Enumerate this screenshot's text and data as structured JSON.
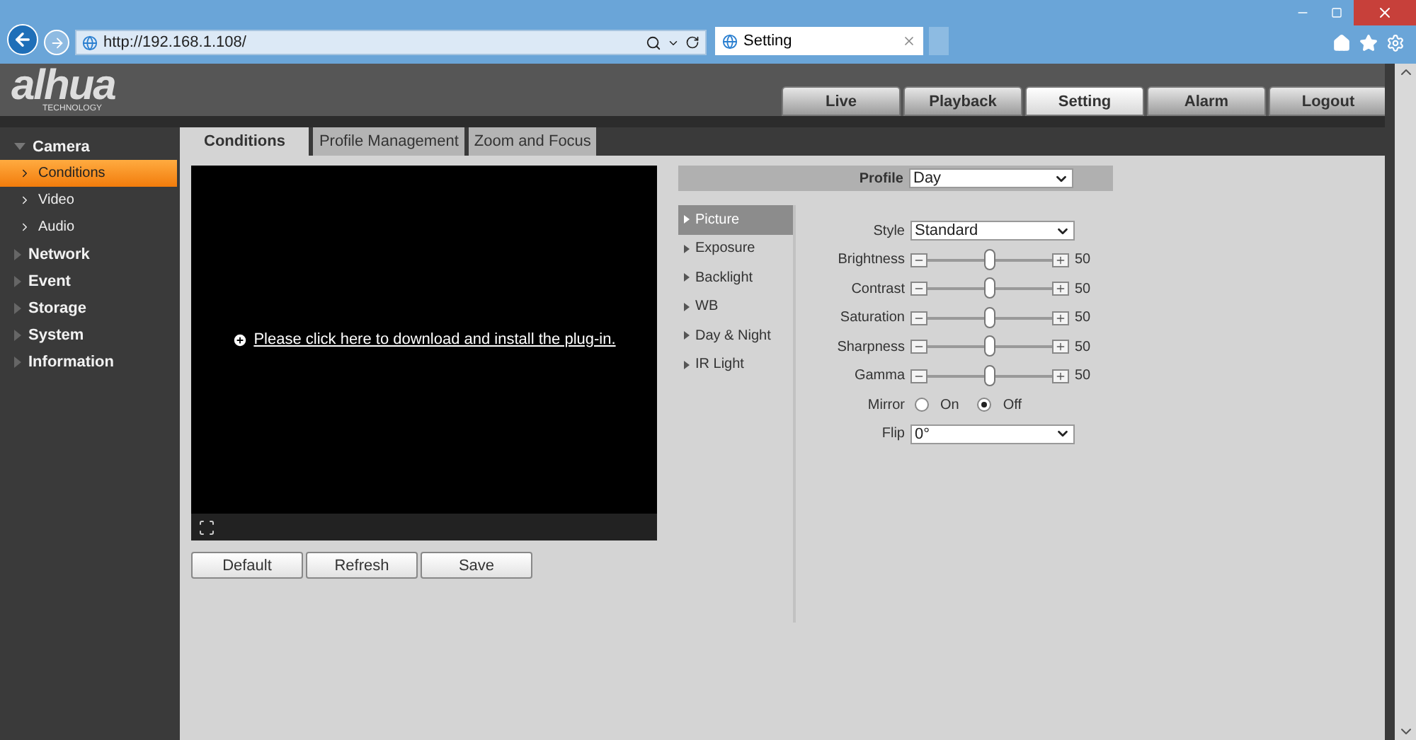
{
  "browser": {
    "url": "http://192.168.1.108/",
    "tab_title": "Setting"
  },
  "logo": {
    "text": "alhua",
    "subtitle": "TECHNOLOGY"
  },
  "nav": [
    {
      "label": "Live",
      "selected": false
    },
    {
      "label": "Playback",
      "selected": false
    },
    {
      "label": "Setting",
      "selected": true
    },
    {
      "label": "Alarm",
      "selected": false
    },
    {
      "label": "Logout",
      "selected": false
    }
  ],
  "sidebar": [
    {
      "label": "Camera",
      "expanded": true,
      "children": [
        {
          "label": "Conditions",
          "selected": true
        },
        {
          "label": "Video",
          "selected": false
        },
        {
          "label": "Audio",
          "selected": false
        }
      ]
    },
    {
      "label": "Network",
      "expanded": false
    },
    {
      "label": "Event",
      "expanded": false
    },
    {
      "label": "Storage",
      "expanded": false
    },
    {
      "label": "System",
      "expanded": false
    },
    {
      "label": "Information",
      "expanded": false
    }
  ],
  "tabs": [
    {
      "label": "Conditions",
      "selected": true
    },
    {
      "label": "Profile Management",
      "selected": false
    },
    {
      "label": "Zoom and Focus",
      "selected": false
    }
  ],
  "video": {
    "plugin_link": "Please click here to download and install the plug-in."
  },
  "buttons": [
    "Default",
    "Refresh",
    "Save"
  ],
  "profile": {
    "label": "Profile",
    "value": "Day"
  },
  "menu": [
    {
      "label": "Picture",
      "selected": true
    },
    {
      "label": "Exposure",
      "selected": false
    },
    {
      "label": "Backlight",
      "selected": false
    },
    {
      "label": "WB",
      "selected": false
    },
    {
      "label": "Day & Night",
      "selected": false
    },
    {
      "label": "IR Light",
      "selected": false
    }
  ],
  "settings": [
    {
      "kind": "select",
      "label": "Style",
      "value": "Standard"
    },
    {
      "kind": "slider",
      "label": "Brightness",
      "level": 0.5,
      "reading": "50"
    },
    {
      "kind": "slider",
      "label": "Contrast",
      "level": 0.5,
      "reading": "50"
    },
    {
      "kind": "slider",
      "label": "Saturation",
      "level": 0.5,
      "reading": "50"
    },
    {
      "kind": "slider",
      "label": "Sharpness",
      "level": 0.5,
      "reading": "50"
    },
    {
      "kind": "slider",
      "label": "Gamma",
      "level": 0.5,
      "reading": "50"
    },
    {
      "kind": "radio",
      "label": "Mirror",
      "options": [
        {
          "label": "On",
          "selected": false
        },
        {
          "label": "Off",
          "selected": true
        }
      ]
    },
    {
      "kind": "select",
      "label": "Flip",
      "value": "0°"
    }
  ]
}
